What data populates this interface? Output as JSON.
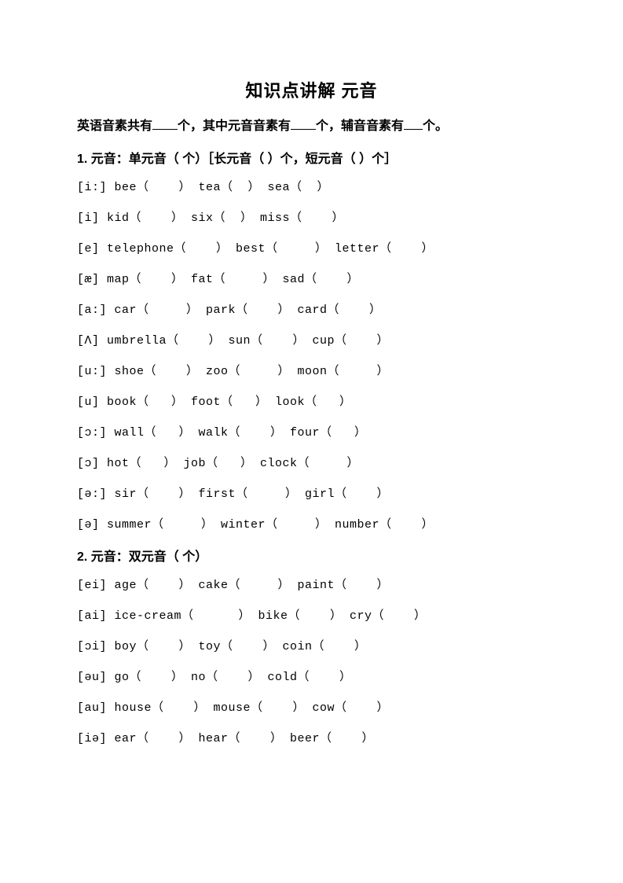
{
  "title": "知识点讲解 元音",
  "intro": {
    "p1": "英语音素共有",
    "p2": "个，其中元音音素有",
    "p3": "个，辅音音素有",
    "p4": "个。"
  },
  "section1_head": "1. 元音：单元音（ 个）［长元音（  ）个，短元音（  ）个］",
  "section2_head": "2. 元音：双元音（  个）",
  "mono": [
    {
      "sym": "[i:]",
      "w": [
        "bee",
        "tea",
        "sea"
      ],
      "g": [
        "    ",
        "  ",
        "  "
      ]
    },
    {
      "sym": "[i]",
      "w": [
        "kid",
        "six",
        "miss"
      ],
      "g": [
        "    ",
        "  ",
        "    "
      ]
    },
    {
      "sym": "[e]",
      "w": [
        "telephone",
        "best",
        "letter"
      ],
      "g": [
        "    ",
        "     ",
        "    "
      ]
    },
    {
      "sym": "[æ]",
      "w": [
        "map",
        "fat",
        "sad"
      ],
      "g": [
        "    ",
        "     ",
        "    "
      ]
    },
    {
      "sym": "[a:]",
      "w": [
        "car",
        "park",
        "card"
      ],
      "g": [
        "     ",
        "    ",
        "    "
      ]
    },
    {
      "sym": "[Λ]",
      "w": [
        "umbrella",
        "sun",
        "cup"
      ],
      "g": [
        "    ",
        "    ",
        "    "
      ]
    },
    {
      "sym": "[u:]",
      "w": [
        "shoe",
        "zoo",
        "moon"
      ],
      "g": [
        "    ",
        "     ",
        "     "
      ]
    },
    {
      "sym": "[u]",
      "w": [
        "book",
        "foot",
        "look"
      ],
      "g": [
        "   ",
        "   ",
        "   "
      ]
    },
    {
      "sym": "[ɔ:]",
      "w": [
        "wall",
        "walk",
        "four"
      ],
      "g": [
        "   ",
        "    ",
        "   "
      ]
    },
    {
      "sym": "[ɔ]",
      "w": [
        "hot",
        "job",
        "clock"
      ],
      "g": [
        "   ",
        "   ",
        "     "
      ]
    },
    {
      "sym": "[ə:]",
      "w": [
        "sir",
        "first",
        "girl"
      ],
      "g": [
        "    ",
        "     ",
        "    "
      ]
    },
    {
      "sym": "[ə]",
      "w": [
        "summer",
        "winter",
        "number"
      ],
      "g": [
        "     ",
        "     ",
        "    "
      ]
    }
  ],
  "diph": [
    {
      "sym": "[ei]",
      "w": [
        "age",
        "cake",
        "paint"
      ],
      "g": [
        "    ",
        "     ",
        "    "
      ]
    },
    {
      "sym": "[ai]",
      "w": [
        "ice-cream",
        "bike",
        "cry"
      ],
      "g": [
        "      ",
        "    ",
        "    "
      ]
    },
    {
      "sym": "[ɔi]",
      "w": [
        "boy",
        "toy",
        "coin"
      ],
      "g": [
        "    ",
        "    ",
        "    "
      ]
    },
    {
      "sym": "[əu]",
      "w": [
        "go",
        "no",
        "cold"
      ],
      "g": [
        "    ",
        "    ",
        "    "
      ]
    },
    {
      "sym": "[au]",
      "w": [
        "house",
        "mouse",
        "cow"
      ],
      "g": [
        "    ",
        "    ",
        "    "
      ]
    },
    {
      "sym": "[iə]",
      "w": [
        "ear",
        "hear",
        "beer"
      ],
      "g": [
        "    ",
        "    ",
        "    "
      ]
    }
  ]
}
